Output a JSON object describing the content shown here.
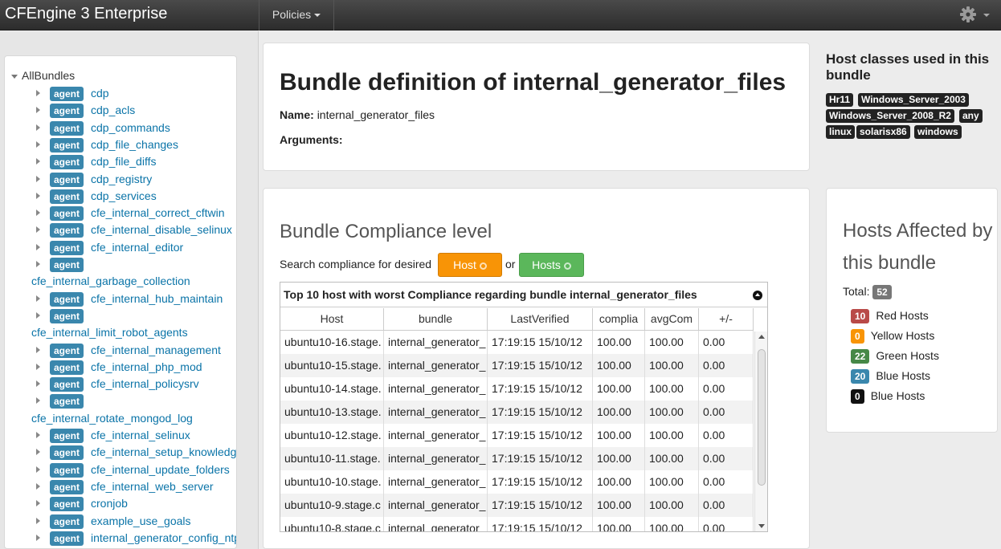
{
  "navbar": {
    "brand": "CFEngine 3 Enterprise",
    "policies_label": "Policies"
  },
  "tree": {
    "root_label": "AllBundles",
    "badge_label": "agent",
    "rows": [
      {
        "type": "agent",
        "label": "cdp"
      },
      {
        "type": "agent",
        "label": "cdp_acls"
      },
      {
        "type": "agent",
        "label": "cdp_commands"
      },
      {
        "type": "agent",
        "label": "cdp_file_changes"
      },
      {
        "type": "agent",
        "label": "cdp_file_diffs"
      },
      {
        "type": "agent",
        "label": "cdp_registry"
      },
      {
        "type": "agent",
        "label": "cdp_services"
      },
      {
        "type": "agent",
        "label": "cfe_internal_correct_cftwin"
      },
      {
        "type": "agent",
        "label": "cfe_internal_disable_selinux"
      },
      {
        "type": "agent",
        "label": "cfe_internal_editor"
      },
      {
        "type": "agent",
        "label": ""
      },
      {
        "type": "plain",
        "label": "cfe_internal_garbage_collection"
      },
      {
        "type": "agent",
        "label": "cfe_internal_hub_maintain"
      },
      {
        "type": "agent",
        "label": ""
      },
      {
        "type": "plain",
        "label": "cfe_internal_limit_robot_agents"
      },
      {
        "type": "agent",
        "label": "cfe_internal_management"
      },
      {
        "type": "agent",
        "label": "cfe_internal_php_mod"
      },
      {
        "type": "agent",
        "label": "cfe_internal_policysrv"
      },
      {
        "type": "agent",
        "label": ""
      },
      {
        "type": "plain",
        "label": "cfe_internal_rotate_mongod_log"
      },
      {
        "type": "agent",
        "label": "cfe_internal_selinux"
      },
      {
        "type": "agent",
        "label": "cfe_internal_setup_knowledge"
      },
      {
        "type": "agent",
        "label": "cfe_internal_update_folders"
      },
      {
        "type": "agent",
        "label": "cfe_internal_web_server"
      },
      {
        "type": "agent",
        "label": "cronjob"
      },
      {
        "type": "agent",
        "label": "example_use_goals"
      },
      {
        "type": "agent",
        "label": "internal_generator_config_ntp"
      }
    ]
  },
  "bundle": {
    "title": "Bundle definition of internal_generator_files",
    "name_label": "Name:",
    "name_value": "internal_generator_files",
    "arguments_label": "Arguments:",
    "arguments_value": ""
  },
  "compliance": {
    "title": "Bundle Compliance level",
    "search_text": "Search compliance for desired",
    "host_button": "Host",
    "or_text": "or",
    "hosts_button": "Hosts",
    "table_title": "Top 10 host with worst Compliance regarding bundle internal_generator_files",
    "columns": [
      "Host",
      "bundle",
      "LastVerified",
      "complia",
      "avgCom",
      "+/-"
    ],
    "rows": [
      [
        "ubuntu10-16.stage.",
        "internal_generator_",
        "17:19:15 15/10/12",
        "100.00",
        "100.00",
        "0.00"
      ],
      [
        "ubuntu10-15.stage.",
        "internal_generator_",
        "17:19:15 15/10/12",
        "100.00",
        "100.00",
        "0.00"
      ],
      [
        "ubuntu10-14.stage.",
        "internal_generator_",
        "17:19:15 15/10/12",
        "100.00",
        "100.00",
        "0.00"
      ],
      [
        "ubuntu10-13.stage.",
        "internal_generator_",
        "17:19:15 15/10/12",
        "100.00",
        "100.00",
        "0.00"
      ],
      [
        "ubuntu10-12.stage.",
        "internal_generator_",
        "17:19:15 15/10/12",
        "100.00",
        "100.00",
        "0.00"
      ],
      [
        "ubuntu10-11.stage.",
        "internal_generator_",
        "17:19:15 15/10/12",
        "100.00",
        "100.00",
        "0.00"
      ],
      [
        "ubuntu10-10.stage.",
        "internal_generator_",
        "17:19:15 15/10/12",
        "100.00",
        "100.00",
        "0.00"
      ],
      [
        "ubuntu10-9.stage.c",
        "internal_generator_",
        "17:19:15 15/10/12",
        "100.00",
        "100.00",
        "0.00"
      ],
      [
        "ubuntu10-8.stage.c",
        "internal_generator_",
        "17:19:15 15/10/12",
        "100.00",
        "100.00",
        "0.00"
      ]
    ]
  },
  "classes": {
    "title": "Host classes used in this bundle",
    "tags": [
      "Hr11",
      "Windows_Server_2003",
      "Windows_Server_2008_R2",
      "any",
      "linux",
      "solarisx86",
      "windows"
    ]
  },
  "hosts_affected": {
    "title": "Hosts Affected by this bundle",
    "total_label": "Total:",
    "total_value": "52",
    "items": [
      {
        "count": "10",
        "label": "Red Hosts",
        "color": "#b94a48"
      },
      {
        "count": "0",
        "label": "Yellow Hosts",
        "color": "#f89406"
      },
      {
        "count": "22",
        "label": "Green Hosts",
        "color": "#468847"
      },
      {
        "count": "20",
        "label": "Blue Hosts",
        "color": "#3a87ad"
      },
      {
        "count": "0",
        "label": "Blue Hosts",
        "color": "#111111"
      }
    ]
  }
}
